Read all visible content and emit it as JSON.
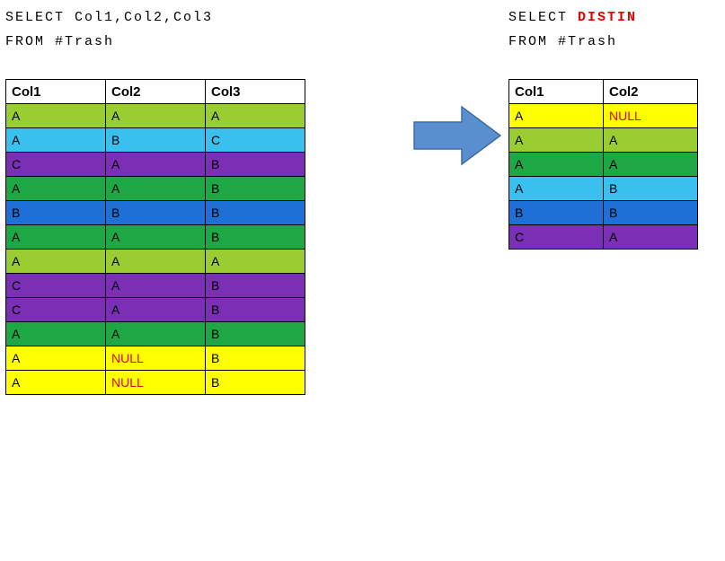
{
  "left": {
    "sql_line1": "SELECT Col1,Col2,Col3",
    "sql_line2": "FROM #Trash",
    "headers": [
      "Col1",
      "Col2",
      "Col3"
    ],
    "rows": [
      {
        "cells": [
          "A",
          "A",
          "A"
        ],
        "color": "lime"
      },
      {
        "cells": [
          "A",
          "B",
          "C"
        ],
        "color": "sky"
      },
      {
        "cells": [
          "C",
          "A",
          "B"
        ],
        "color": "purple"
      },
      {
        "cells": [
          "A",
          "A",
          "B"
        ],
        "color": "green"
      },
      {
        "cells": [
          "B",
          "B",
          "B"
        ],
        "color": "blue"
      },
      {
        "cells": [
          "A",
          "A",
          "B"
        ],
        "color": "green"
      },
      {
        "cells": [
          "A",
          "A",
          "A"
        ],
        "color": "lime"
      },
      {
        "cells": [
          "C",
          "A",
          "B"
        ],
        "color": "purple"
      },
      {
        "cells": [
          "C",
          "A",
          "B"
        ],
        "color": "purple"
      },
      {
        "cells": [
          "A",
          "A",
          "B"
        ],
        "color": "green"
      },
      {
        "cells": [
          "A",
          "NULL",
          "B"
        ],
        "color": "yellow",
        "null_col": 1
      },
      {
        "cells": [
          "A",
          "NULL",
          "B"
        ],
        "color": "yellow",
        "null_col": 1
      }
    ]
  },
  "right": {
    "sql_line1_a": "SELECT ",
    "sql_line1_b": "DISTIN",
    "sql_line2": "FROM #Trash",
    "headers": [
      "Col1",
      "Col2"
    ],
    "rows": [
      {
        "cells": [
          "A",
          "NULL"
        ],
        "color": "yellow",
        "null_col": 1
      },
      {
        "cells": [
          "A",
          "A"
        ],
        "color": "lime"
      },
      {
        "cells": [
          "A",
          "A"
        ],
        "color": "green"
      },
      {
        "cells": [
          "A",
          "B"
        ],
        "color": "sky"
      },
      {
        "cells": [
          "B",
          "B"
        ],
        "color": "blue"
      },
      {
        "cells": [
          "C",
          "A"
        ],
        "color": "purple"
      }
    ]
  },
  "chart_data": {
    "type": "table",
    "description": "Illustration of SQL SELECT vs SELECT DISTINCT on #Trash. Left table shows raw rows; arrow points to right table showing distinct Col1,Col2 pairs (truncated view).",
    "left_query": "SELECT Col1,Col2,Col3 FROM #Trash",
    "right_query_visible": "SELECT DISTIN... FROM #Trash",
    "left_table": {
      "columns": [
        "Col1",
        "Col2",
        "Col3"
      ],
      "rows": [
        [
          "A",
          "A",
          "A"
        ],
        [
          "A",
          "B",
          "C"
        ],
        [
          "C",
          "A",
          "B"
        ],
        [
          "A",
          "A",
          "B"
        ],
        [
          "B",
          "B",
          "B"
        ],
        [
          "A",
          "A",
          "B"
        ],
        [
          "A",
          "A",
          "A"
        ],
        [
          "C",
          "A",
          "B"
        ],
        [
          "C",
          "A",
          "B"
        ],
        [
          "A",
          "A",
          "B"
        ],
        [
          "A",
          null,
          "B"
        ],
        [
          "A",
          null,
          "B"
        ]
      ]
    },
    "right_table": {
      "columns": [
        "Col1",
        "Col2"
      ],
      "rows": [
        [
          "A",
          null
        ],
        [
          "A",
          "A"
        ],
        [
          "A",
          "A"
        ],
        [
          "A",
          "B"
        ],
        [
          "B",
          "B"
        ],
        [
          "C",
          "A"
        ]
      ]
    },
    "row_colors_legend": {
      "lime": "#9acd32",
      "sky": "#39c0ee",
      "purple": "#7b2fb5",
      "green": "#1ea845",
      "blue": "#1e6fd6",
      "yellow": "#ffff00"
    }
  }
}
